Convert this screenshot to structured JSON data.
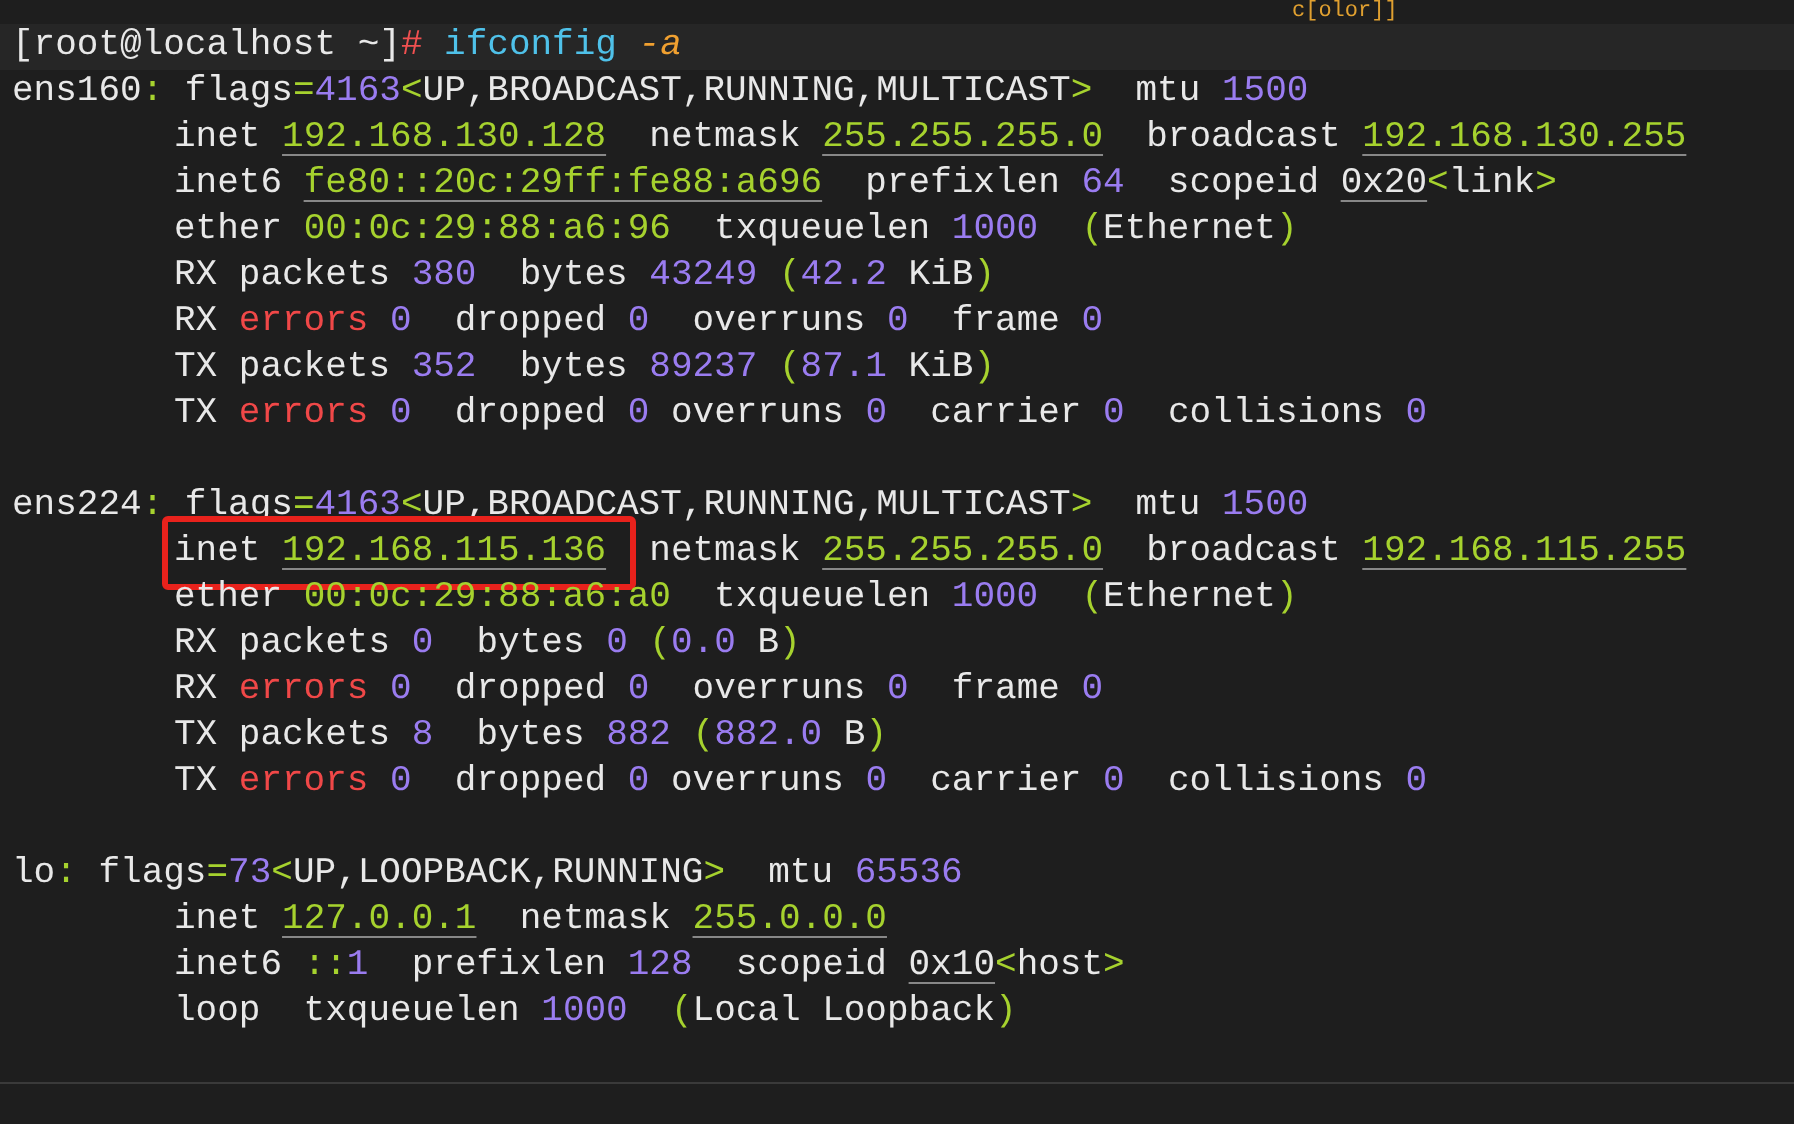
{
  "partial_top_line": "c[olor]]",
  "prompt": [
    {
      "kind": "text",
      "text": "[root@localhost ~]"
    },
    {
      "kind": "hash",
      "text": "#"
    },
    {
      "kind": "cmd",
      "text": " ifconfig"
    },
    {
      "kind": "flag",
      "text": " -a"
    }
  ],
  "interfaces": [
    {
      "lines": [
        [
          {
            "kind": "text",
            "text": "ens160"
          },
          {
            "kind": "green",
            "text": ":"
          },
          {
            "kind": "text",
            "text": " flags"
          },
          {
            "kind": "green",
            "text": "="
          },
          {
            "kind": "num",
            "text": "4163"
          },
          {
            "kind": "green",
            "text": "<"
          },
          {
            "kind": "text",
            "text": "UP,BROADCAST,RUNNING,MULTICAST"
          },
          {
            "kind": "green",
            "text": ">"
          },
          {
            "kind": "text",
            "text": "  mtu "
          },
          {
            "kind": "num",
            "text": "1500"
          }
        ],
        [
          {
            "kind": "text",
            "text": "inet "
          },
          {
            "kind": "link",
            "text": "192.168.130.128"
          },
          {
            "kind": "text",
            "text": "  netmask "
          },
          {
            "kind": "link",
            "text": "255.255.255.0"
          },
          {
            "kind": "text",
            "text": "  broadcast "
          },
          {
            "kind": "link",
            "text": "192.168.130.255"
          }
        ],
        [
          {
            "kind": "text",
            "text": "inet6 "
          },
          {
            "kind": "link",
            "text": "fe80::20c:29ff:fe88:a696"
          },
          {
            "kind": "text",
            "text": "  prefixlen "
          },
          {
            "kind": "num",
            "text": "64"
          },
          {
            "kind": "text",
            "text": "  scopeid "
          },
          {
            "kind": "uline",
            "text": "0x20"
          },
          {
            "kind": "green",
            "text": "<"
          },
          {
            "kind": "text",
            "text": "link"
          },
          {
            "kind": "green",
            "text": ">"
          }
        ],
        [
          {
            "kind": "text",
            "text": "ether "
          },
          {
            "kind": "green",
            "text": "00:0c:29:88:a6:96"
          },
          {
            "kind": "text",
            "text": "  txqueuelen "
          },
          {
            "kind": "num",
            "text": "1000"
          },
          {
            "kind": "green",
            "text": "  ("
          },
          {
            "kind": "text",
            "text": "Ethernet"
          },
          {
            "kind": "green",
            "text": ")"
          }
        ],
        [
          {
            "kind": "text",
            "text": "RX packets "
          },
          {
            "kind": "num",
            "text": "380"
          },
          {
            "kind": "text",
            "text": "  bytes "
          },
          {
            "kind": "num",
            "text": "43249"
          },
          {
            "kind": "green",
            "text": " ("
          },
          {
            "kind": "num",
            "text": "42.2"
          },
          {
            "kind": "text",
            "text": " KiB"
          },
          {
            "kind": "green",
            "text": ")"
          }
        ],
        [
          {
            "kind": "text",
            "text": "RX "
          },
          {
            "kind": "error",
            "text": "errors"
          },
          {
            "kind": "num",
            "text": " 0"
          },
          {
            "kind": "text",
            "text": "  dropped "
          },
          {
            "kind": "num",
            "text": "0"
          },
          {
            "kind": "text",
            "text": "  overruns "
          },
          {
            "kind": "num",
            "text": "0"
          },
          {
            "kind": "text",
            "text": "  frame "
          },
          {
            "kind": "num",
            "text": "0"
          }
        ],
        [
          {
            "kind": "text",
            "text": "TX packets "
          },
          {
            "kind": "num",
            "text": "352"
          },
          {
            "kind": "text",
            "text": "  bytes "
          },
          {
            "kind": "num",
            "text": "89237"
          },
          {
            "kind": "green",
            "text": " ("
          },
          {
            "kind": "num",
            "text": "87.1"
          },
          {
            "kind": "text",
            "text": " KiB"
          },
          {
            "kind": "green",
            "text": ")"
          }
        ],
        [
          {
            "kind": "text",
            "text": "TX "
          },
          {
            "kind": "error",
            "text": "errors"
          },
          {
            "kind": "num",
            "text": " 0"
          },
          {
            "kind": "text",
            "text": "  dropped "
          },
          {
            "kind": "num",
            "text": "0"
          },
          {
            "kind": "text",
            "text": " overruns "
          },
          {
            "kind": "num",
            "text": "0"
          },
          {
            "kind": "text",
            "text": "  carrier "
          },
          {
            "kind": "num",
            "text": "0"
          },
          {
            "kind": "text",
            "text": "  collisions "
          },
          {
            "kind": "num",
            "text": "0"
          }
        ]
      ]
    },
    {
      "lines": [
        [
          {
            "kind": "text",
            "text": "ens224"
          },
          {
            "kind": "green",
            "text": ":"
          },
          {
            "kind": "text",
            "text": " flags"
          },
          {
            "kind": "green",
            "text": "="
          },
          {
            "kind": "num",
            "text": "4163"
          },
          {
            "kind": "green",
            "text": "<"
          },
          {
            "kind": "text",
            "text": "UP,BROADCAST,RUNNING,MULTICAST"
          },
          {
            "kind": "green",
            "text": ">"
          },
          {
            "kind": "text",
            "text": "  mtu "
          },
          {
            "kind": "num",
            "text": "1500"
          }
        ],
        [
          {
            "kind": "text",
            "text": "inet ",
            "boxed": true
          },
          {
            "kind": "link",
            "text": "192.168.115.136",
            "boxed": true
          },
          {
            "kind": "text",
            "text": "  netmask "
          },
          {
            "kind": "link",
            "text": "255.255.255.0"
          },
          {
            "kind": "text",
            "text": "  broadcast "
          },
          {
            "kind": "link",
            "text": "192.168.115.255"
          }
        ],
        [
          {
            "kind": "text",
            "text": "ether "
          },
          {
            "kind": "green",
            "text": "00:0c:29:88:a6:a0"
          },
          {
            "kind": "text",
            "text": "  txqueuelen "
          },
          {
            "kind": "num",
            "text": "1000"
          },
          {
            "kind": "green",
            "text": "  ("
          },
          {
            "kind": "text",
            "text": "Ethernet"
          },
          {
            "kind": "green",
            "text": ")"
          }
        ],
        [
          {
            "kind": "text",
            "text": "RX packets "
          },
          {
            "kind": "num",
            "text": "0"
          },
          {
            "kind": "text",
            "text": "  bytes "
          },
          {
            "kind": "num",
            "text": "0"
          },
          {
            "kind": "green",
            "text": " ("
          },
          {
            "kind": "num",
            "text": "0.0"
          },
          {
            "kind": "text",
            "text": " B"
          },
          {
            "kind": "green",
            "text": ")"
          }
        ],
        [
          {
            "kind": "text",
            "text": "RX "
          },
          {
            "kind": "error",
            "text": "errors"
          },
          {
            "kind": "num",
            "text": " 0"
          },
          {
            "kind": "text",
            "text": "  dropped "
          },
          {
            "kind": "num",
            "text": "0"
          },
          {
            "kind": "text",
            "text": "  overruns "
          },
          {
            "kind": "num",
            "text": "0"
          },
          {
            "kind": "text",
            "text": "  frame "
          },
          {
            "kind": "num",
            "text": "0"
          }
        ],
        [
          {
            "kind": "text",
            "text": "TX packets "
          },
          {
            "kind": "num",
            "text": "8"
          },
          {
            "kind": "text",
            "text": "  bytes "
          },
          {
            "kind": "num",
            "text": "882"
          },
          {
            "kind": "green",
            "text": " ("
          },
          {
            "kind": "num",
            "text": "882.0"
          },
          {
            "kind": "text",
            "text": " B"
          },
          {
            "kind": "green",
            "text": ")"
          }
        ],
        [
          {
            "kind": "text",
            "text": "TX "
          },
          {
            "kind": "error",
            "text": "errors"
          },
          {
            "kind": "num",
            "text": " 0"
          },
          {
            "kind": "text",
            "text": "  dropped "
          },
          {
            "kind": "num",
            "text": "0"
          },
          {
            "kind": "text",
            "text": " overruns "
          },
          {
            "kind": "num",
            "text": "0"
          },
          {
            "kind": "text",
            "text": "  carrier "
          },
          {
            "kind": "num",
            "text": "0"
          },
          {
            "kind": "text",
            "text": "  collisions "
          },
          {
            "kind": "num",
            "text": "0"
          }
        ]
      ]
    },
    {
      "lines": [
        [
          {
            "kind": "text",
            "text": "lo"
          },
          {
            "kind": "green",
            "text": ":"
          },
          {
            "kind": "text",
            "text": " flags"
          },
          {
            "kind": "green",
            "text": "="
          },
          {
            "kind": "num",
            "text": "73"
          },
          {
            "kind": "green",
            "text": "<"
          },
          {
            "kind": "text",
            "text": "UP,LOOPBACK,RUNNING"
          },
          {
            "kind": "green",
            "text": ">"
          },
          {
            "kind": "text",
            "text": "  mtu "
          },
          {
            "kind": "num",
            "text": "65536"
          }
        ],
        [
          {
            "kind": "text",
            "text": "inet "
          },
          {
            "kind": "link",
            "text": "127.0.0.1"
          },
          {
            "kind": "text",
            "text": "  netmask "
          },
          {
            "kind": "link",
            "text": "255.0.0.0"
          }
        ],
        [
          {
            "kind": "text",
            "text": "inet6 "
          },
          {
            "kind": "green",
            "text": "::"
          },
          {
            "kind": "num",
            "text": "1"
          },
          {
            "kind": "text",
            "text": "  prefixlen "
          },
          {
            "kind": "num",
            "text": "128"
          },
          {
            "kind": "text",
            "text": "  scopeid "
          },
          {
            "kind": "uline",
            "text": "0x10"
          },
          {
            "kind": "green",
            "text": "<"
          },
          {
            "kind": "text",
            "text": "host"
          },
          {
            "kind": "green",
            "text": ">"
          }
        ],
        [
          {
            "kind": "text",
            "text": "loop  txqueuelen "
          },
          {
            "kind": "num",
            "text": "1000"
          },
          {
            "kind": "green",
            "text": "  ("
          },
          {
            "kind": "text",
            "text": "Local Loopback"
          },
          {
            "kind": "green",
            "text": ")"
          }
        ]
      ]
    }
  ]
}
